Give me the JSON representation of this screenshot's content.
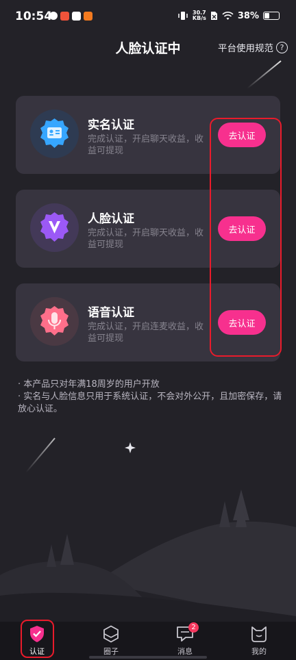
{
  "status_bar": {
    "time": "10:54",
    "net_speed_value": "30.7",
    "net_speed_unit": "KB/s",
    "battery_percent": "38%",
    "battery_level": 0.38
  },
  "header": {
    "title": "人脸认证中",
    "rules_label": "平台使用规范",
    "help_glyph": "?"
  },
  "cards": [
    {
      "name": "实名认证",
      "desc": "完成认证，开启聊天收益，收益可提现",
      "button": "去认证",
      "icon": "id-card-icon",
      "color": "#36a6ff"
    },
    {
      "name": "人脸认证",
      "desc": "完成认证，开启聊天收益，收益可提现",
      "button": "去认证",
      "icon": "v-badge-icon",
      "color": "#9b59f6"
    },
    {
      "name": "语音认证",
      "desc": "完成认证，开启连麦收益，收益可提现",
      "button": "去认证",
      "icon": "microphone-icon",
      "color": "#ff6f8a"
    }
  ],
  "notes": [
    "· 本产品只对年满18周岁的用户开放",
    "· 实名与人脸信息只用于系统认证，不会对外公开，且加密保存，请放心认证。"
  ],
  "tabs": [
    {
      "label": "认证",
      "icon": "shield-check-icon",
      "active": true
    },
    {
      "label": "圈子",
      "icon": "hexagon-icon"
    },
    {
      "label": "消息",
      "icon": "chat-icon",
      "badge": "2"
    },
    {
      "label": "我的",
      "icon": "cat-face-icon"
    }
  ],
  "colors": {
    "background": "#232228",
    "card": "#37343f",
    "accent": "#f7308e",
    "highlight_outline": "#ea1b2b"
  }
}
